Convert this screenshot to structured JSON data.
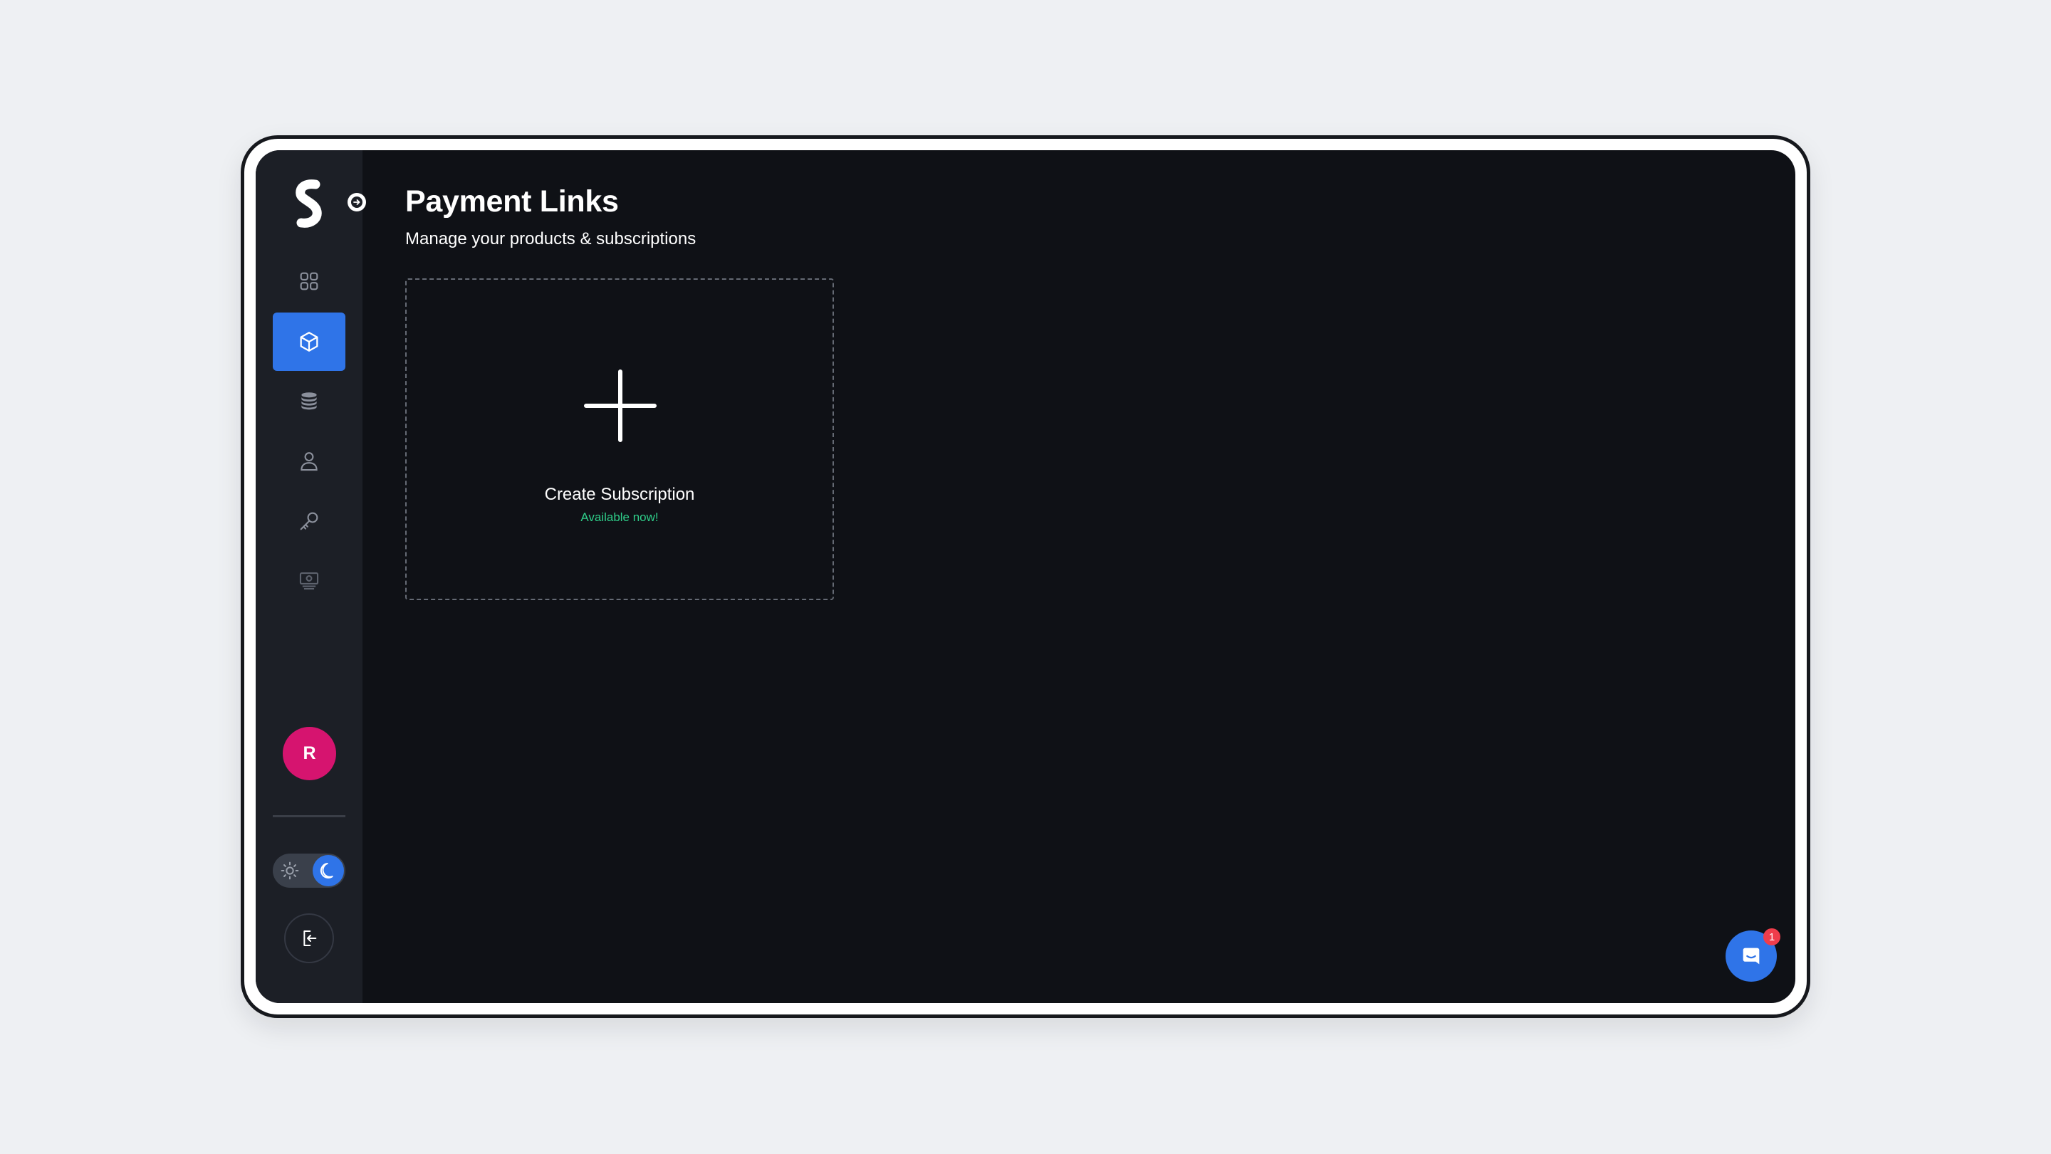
{
  "app": {
    "brand_letter": "S"
  },
  "sidebar": {
    "items": [
      {
        "name": "dashboard",
        "icon": "grid-icon",
        "active": false
      },
      {
        "name": "products",
        "icon": "cube-icon",
        "active": true
      },
      {
        "name": "database",
        "icon": "coins-stack-icon",
        "active": false
      },
      {
        "name": "customers",
        "icon": "user-icon",
        "active": false
      },
      {
        "name": "api-keys",
        "icon": "key-icon",
        "active": false
      },
      {
        "name": "payouts",
        "icon": "banknote-icon",
        "active": false
      }
    ],
    "avatar_initial": "R",
    "theme": {
      "selected": "dark"
    }
  },
  "page": {
    "title": "Payment Links",
    "subtitle": "Manage your products & subscriptions"
  },
  "create_card": {
    "title": "Create Subscription",
    "status": "Available now!"
  },
  "chat": {
    "badge_count": "1"
  },
  "colors": {
    "accent": "#2f74e8",
    "sidebar_bg": "#1c1f26",
    "main_bg": "#0f1116",
    "avatar_bg": "#d6146f",
    "available_green": "#2fcf8a",
    "badge_red": "#ef3d4b"
  }
}
